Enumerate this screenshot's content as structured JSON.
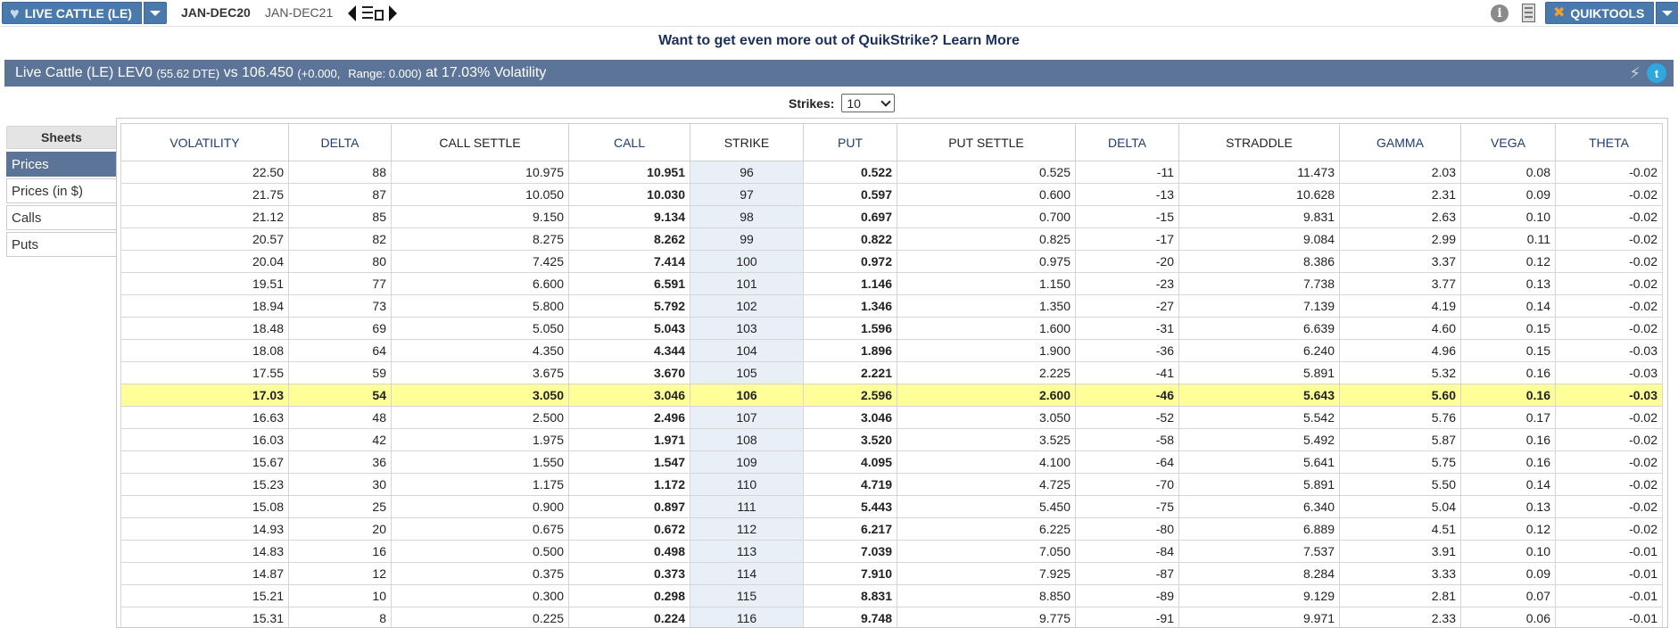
{
  "toolbar": {
    "product_label": "LIVE CATTLE (LE)",
    "expiry_active": "JAN-DEC20",
    "expiry_inactive": "JAN-DEC21",
    "tools_label": "QUIKTOOLS"
  },
  "promo": {
    "question": "Want to get even more out of QuikStrike?",
    "link": "Learn More"
  },
  "banner": {
    "product": "Live Cattle (LE) LEV0",
    "dte": "(55.62 DTE)",
    "vs_price": "vs 106.450",
    "change": "(+0.000,",
    "range": "Range: 0.000)",
    "volatility": "at 17.03% Volatility"
  },
  "strikes": {
    "label": "Strikes:",
    "value": "10"
  },
  "sheets": {
    "header": "Sheets",
    "items": [
      {
        "label": "Prices",
        "active": true
      },
      {
        "label": "Prices (in $)",
        "active": false
      },
      {
        "label": "Calls",
        "active": false
      },
      {
        "label": "Puts",
        "active": false
      }
    ]
  },
  "table": {
    "columns": [
      "VOLATILITY",
      "DELTA",
      "CALL SETTLE",
      "CALL",
      "STRIKE",
      "PUT",
      "PUT SETTLE",
      "DELTA",
      "STRADDLE",
      "GAMMA",
      "VEGA",
      "THETA"
    ],
    "atm_strike": "106",
    "rows": [
      [
        "22.50",
        "88",
        "10.975",
        "10.951",
        "96",
        "0.522",
        "0.525",
        "-11",
        "11.473",
        "2.03",
        "0.08",
        "-0.02"
      ],
      [
        "21.75",
        "87",
        "10.050",
        "10.030",
        "97",
        "0.597",
        "0.600",
        "-13",
        "10.628",
        "2.31",
        "0.09",
        "-0.02"
      ],
      [
        "21.12",
        "85",
        "9.150",
        "9.134",
        "98",
        "0.697",
        "0.700",
        "-15",
        "9.831",
        "2.63",
        "0.10",
        "-0.02"
      ],
      [
        "20.57",
        "82",
        "8.275",
        "8.262",
        "99",
        "0.822",
        "0.825",
        "-17",
        "9.084",
        "2.99",
        "0.11",
        "-0.02"
      ],
      [
        "20.04",
        "80",
        "7.425",
        "7.414",
        "100",
        "0.972",
        "0.975",
        "-20",
        "8.386",
        "3.37",
        "0.12",
        "-0.02"
      ],
      [
        "19.51",
        "77",
        "6.600",
        "6.591",
        "101",
        "1.146",
        "1.150",
        "-23",
        "7.738",
        "3.77",
        "0.13",
        "-0.02"
      ],
      [
        "18.94",
        "73",
        "5.800",
        "5.792",
        "102",
        "1.346",
        "1.350",
        "-27",
        "7.139",
        "4.19",
        "0.14",
        "-0.02"
      ],
      [
        "18.48",
        "69",
        "5.050",
        "5.043",
        "103",
        "1.596",
        "1.600",
        "-31",
        "6.639",
        "4.60",
        "0.15",
        "-0.02"
      ],
      [
        "18.08",
        "64",
        "4.350",
        "4.344",
        "104",
        "1.896",
        "1.900",
        "-36",
        "6.240",
        "4.96",
        "0.15",
        "-0.03"
      ],
      [
        "17.55",
        "59",
        "3.675",
        "3.670",
        "105",
        "2.221",
        "2.225",
        "-41",
        "5.891",
        "5.32",
        "0.16",
        "-0.03"
      ],
      [
        "17.03",
        "54",
        "3.050",
        "3.046",
        "106",
        "2.596",
        "2.600",
        "-46",
        "5.643",
        "5.60",
        "0.16",
        "-0.03"
      ],
      [
        "16.63",
        "48",
        "2.500",
        "2.496",
        "107",
        "3.046",
        "3.050",
        "-52",
        "5.542",
        "5.76",
        "0.17",
        "-0.02"
      ],
      [
        "16.03",
        "42",
        "1.975",
        "1.971",
        "108",
        "3.520",
        "3.525",
        "-58",
        "5.492",
        "5.87",
        "0.16",
        "-0.02"
      ],
      [
        "15.67",
        "36",
        "1.550",
        "1.547",
        "109",
        "4.095",
        "4.100",
        "-64",
        "5.641",
        "5.75",
        "0.16",
        "-0.02"
      ],
      [
        "15.23",
        "30",
        "1.175",
        "1.172",
        "110",
        "4.719",
        "4.725",
        "-70",
        "5.891",
        "5.50",
        "0.14",
        "-0.02"
      ],
      [
        "15.08",
        "25",
        "0.900",
        "0.897",
        "111",
        "5.443",
        "5.450",
        "-75",
        "6.340",
        "5.04",
        "0.13",
        "-0.02"
      ],
      [
        "14.93",
        "20",
        "0.675",
        "0.672",
        "112",
        "6.217",
        "6.225",
        "-80",
        "6.889",
        "4.51",
        "0.12",
        "-0.02"
      ],
      [
        "14.83",
        "16",
        "0.500",
        "0.498",
        "113",
        "7.039",
        "7.050",
        "-84",
        "7.537",
        "3.91",
        "0.10",
        "-0.01"
      ],
      [
        "14.87",
        "12",
        "0.375",
        "0.373",
        "114",
        "7.910",
        "7.925",
        "-87",
        "8.284",
        "3.33",
        "0.09",
        "-0.01"
      ],
      [
        "15.21",
        "10",
        "0.300",
        "0.298",
        "115",
        "8.831",
        "8.850",
        "-89",
        "9.129",
        "2.81",
        "0.07",
        "-0.01"
      ],
      [
        "15.31",
        "8",
        "0.225",
        "0.224",
        "116",
        "9.748",
        "9.775",
        "-91",
        "9.971",
        "2.33",
        "0.06",
        "-0.01"
      ]
    ]
  },
  "colors": {
    "accent": "#4a7aab",
    "banner": "#5b7497",
    "atm_highlight": "#ffff99",
    "strike_column": "#e9eff7",
    "header_text": "#1e3d70"
  }
}
